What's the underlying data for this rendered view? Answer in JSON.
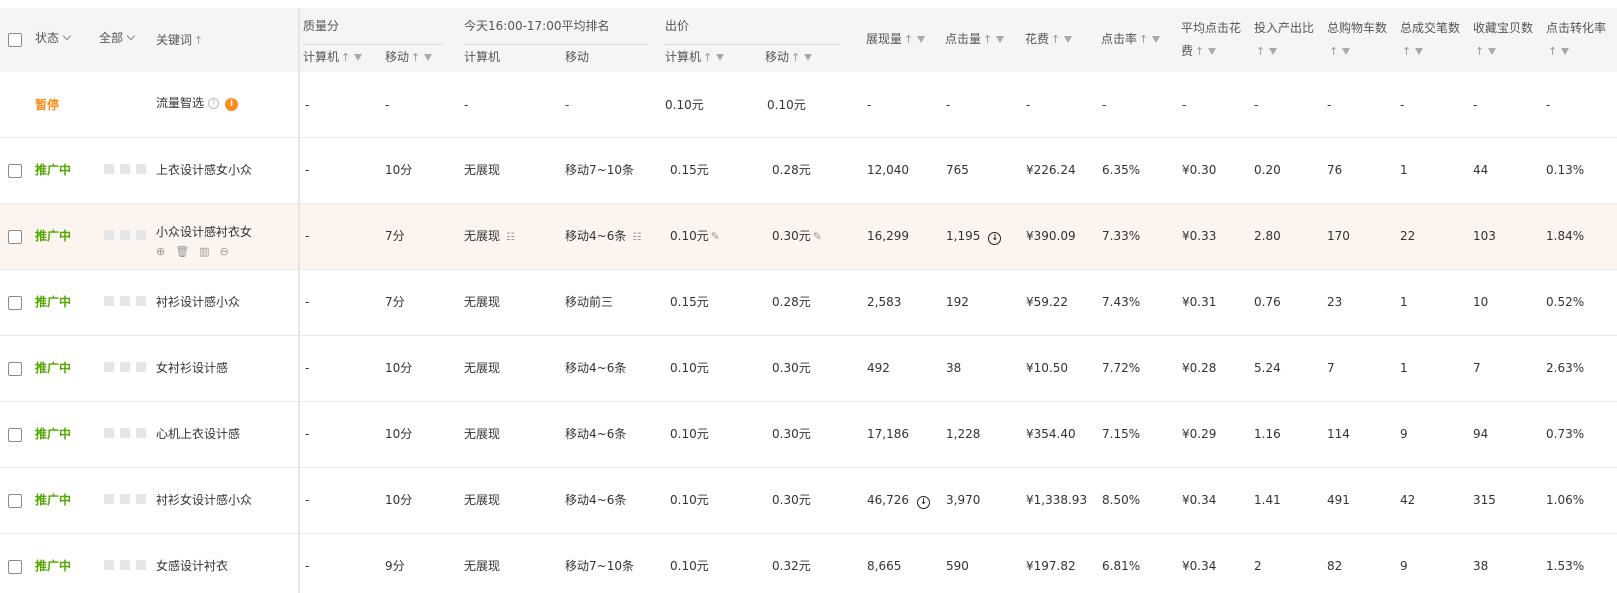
{
  "header": {
    "status": "状态",
    "all": "全部",
    "keyword": "关键词",
    "quality": "质量分",
    "ranking": "今天16:00-17:00平均排名",
    "bid": "出价",
    "pc": "计算机",
    "mobile": "移动",
    "impressions": "展现量",
    "clicks": "点击量",
    "cost": "花费",
    "ctr": "点击率",
    "avg_cpc_line1": "平均点击花",
    "avg_cpc_line2": "费",
    "roi": "投入产出比",
    "cart": "总购物车数",
    "orders": "总成交笔数",
    "favorites": "收藏宝贝数",
    "cvr": "点击转化率",
    "sort_up": "↑"
  },
  "rows": [
    {
      "status": "暂停",
      "keyword": "流量智选",
      "q_pc": "-",
      "q_mobile": "-",
      "r_pc": "-",
      "r_mobile": "-",
      "bid_pc": "0.10元",
      "bid_mobile": "0.10元",
      "impressions": "-",
      "clicks": "-",
      "cost": "-",
      "ctr": "-",
      "cpc": "-",
      "roi": "-",
      "cart": "-",
      "orders": "-",
      "fav": "-",
      "cvr": "-"
    },
    {
      "status": "推广中",
      "keyword": "上衣设计感女小众",
      "q_pc": "-",
      "q_mobile": "10分",
      "r_pc": "无展现",
      "r_mobile": "移动7~10条",
      "bid_pc": "0.15元",
      "bid_mobile": "0.28元",
      "impressions": "12,040",
      "clicks": "765",
      "cost": "¥226.24",
      "ctr": "6.35%",
      "cpc": "¥0.30",
      "roi": "0.20",
      "cart": "76",
      "orders": "1",
      "fav": "44",
      "cvr": "0.13%"
    },
    {
      "status": "推广中",
      "keyword": "小众设计感衬衣女",
      "q_pc": "-",
      "q_mobile": "7分",
      "r_pc": "无展现",
      "r_mobile": "移动4~6条",
      "bid_pc": "0.10元",
      "bid_mobile": "0.30元",
      "impressions": "16,299",
      "clicks": "1,195",
      "cost": "¥390.09",
      "ctr": "7.33%",
      "cpc": "¥0.33",
      "roi": "2.80",
      "cart": "170",
      "orders": "22",
      "fav": "103",
      "cvr": "1.84%"
    },
    {
      "status": "推广中",
      "keyword": "衬衫设计感小众",
      "q_pc": "-",
      "q_mobile": "7分",
      "r_pc": "无展现",
      "r_mobile": "移动前三",
      "bid_pc": "0.15元",
      "bid_mobile": "0.28元",
      "impressions": "2,583",
      "clicks": "192",
      "cost": "¥59.22",
      "ctr": "7.43%",
      "cpc": "¥0.31",
      "roi": "0.76",
      "cart": "23",
      "orders": "1",
      "fav": "10",
      "cvr": "0.52%"
    },
    {
      "status": "推广中",
      "keyword": "女衬衫设计感",
      "q_pc": "-",
      "q_mobile": "10分",
      "r_pc": "无展现",
      "r_mobile": "移动4~6条",
      "bid_pc": "0.10元",
      "bid_mobile": "0.30元",
      "impressions": "492",
      "clicks": "38",
      "cost": "¥10.50",
      "ctr": "7.72%",
      "cpc": "¥0.28",
      "roi": "5.24",
      "cart": "7",
      "orders": "1",
      "fav": "7",
      "cvr": "2.63%"
    },
    {
      "status": "推广中",
      "keyword": "心机上衣设计感",
      "q_pc": "-",
      "q_mobile": "10分",
      "r_pc": "无展现",
      "r_mobile": "移动4~6条",
      "bid_pc": "0.10元",
      "bid_mobile": "0.30元",
      "impressions": "17,186",
      "clicks": "1,228",
      "cost": "¥354.40",
      "ctr": "7.15%",
      "cpc": "¥0.29",
      "roi": "1.16",
      "cart": "114",
      "orders": "9",
      "fav": "94",
      "cvr": "0.73%"
    },
    {
      "status": "推广中",
      "keyword": "衬衫女设计感小众",
      "q_pc": "-",
      "q_mobile": "10分",
      "r_pc": "无展现",
      "r_mobile": "移动4~6条",
      "bid_pc": "0.10元",
      "bid_mobile": "0.30元",
      "impressions": "46,726",
      "clicks": "3,970",
      "cost": "¥1,338.93",
      "ctr": "8.50%",
      "cpc": "¥0.34",
      "roi": "1.41",
      "cart": "491",
      "orders": "42",
      "fav": "315",
      "cvr": "1.06%"
    },
    {
      "status": "推广中",
      "keyword": "女感设计衬衣",
      "q_pc": "-",
      "q_mobile": "9分",
      "r_pc": "无展现",
      "r_mobile": "移动7~10条",
      "bid_pc": "0.10元",
      "bid_mobile": "0.32元",
      "impressions": "8,665",
      "clicks": "590",
      "cost": "¥197.82",
      "ctr": "6.81%",
      "cpc": "¥0.34",
      "roi": "2",
      "cart": "82",
      "orders": "9",
      "fav": "38",
      "cvr": "1.53%"
    }
  ],
  "icons": {
    "help": "?",
    "info": "i",
    "download": "↓"
  },
  "colors": {
    "promoting": "#52a600",
    "paused": "#ff8c1a",
    "highlight_row": "#fcf4ee"
  }
}
